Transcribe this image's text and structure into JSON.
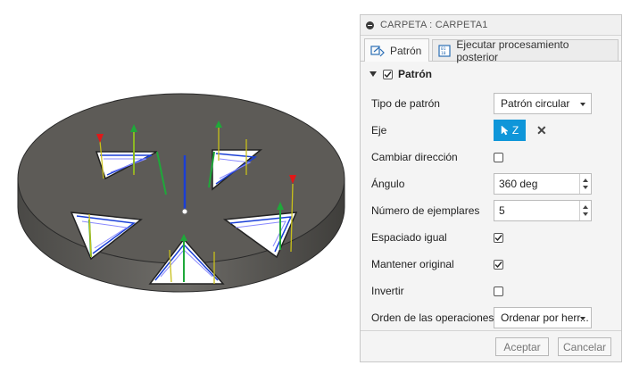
{
  "panel": {
    "title": "CARPETA : CARPETA1",
    "tabs": [
      {
        "label": "Patrón",
        "icon": "pattern-tab-icon"
      },
      {
        "label": "Ejecutar procesamiento posterior",
        "icon": "postprocess-tab-icon"
      }
    ],
    "section": {
      "label": "Patrón",
      "checked": true
    },
    "fields": {
      "tipo_patron": {
        "label": "Tipo de patrón",
        "value": "Patrón circular"
      },
      "eje": {
        "label": "Eje",
        "value": "Z"
      },
      "cambiar_direccion": {
        "label": "Cambiar dirección",
        "checked": false
      },
      "angulo": {
        "label": "Ángulo",
        "value": "360 deg"
      },
      "num_ejemplares": {
        "label": "Número de ejemplares",
        "value": "5"
      },
      "espaciado_igual": {
        "label": "Espaciado igual",
        "checked": true
      },
      "mantener_original": {
        "label": "Mantener original",
        "checked": true
      },
      "invertir": {
        "label": "Invertir",
        "checked": false
      },
      "orden_operaciones": {
        "label": "Orden de las operaciones",
        "value": "Ordenar por herr..."
      }
    },
    "buttons": {
      "accept": "Aceptar",
      "cancel": "Cancelar"
    }
  },
  "colors": {
    "accent": "#0f96d9",
    "part": "#5c5a55",
    "toolpath_blue": "#1a3fd6",
    "toolpath_green": "#1fa83a",
    "marker_red": "#e01818",
    "marker_yellow": "#c8c01a"
  }
}
